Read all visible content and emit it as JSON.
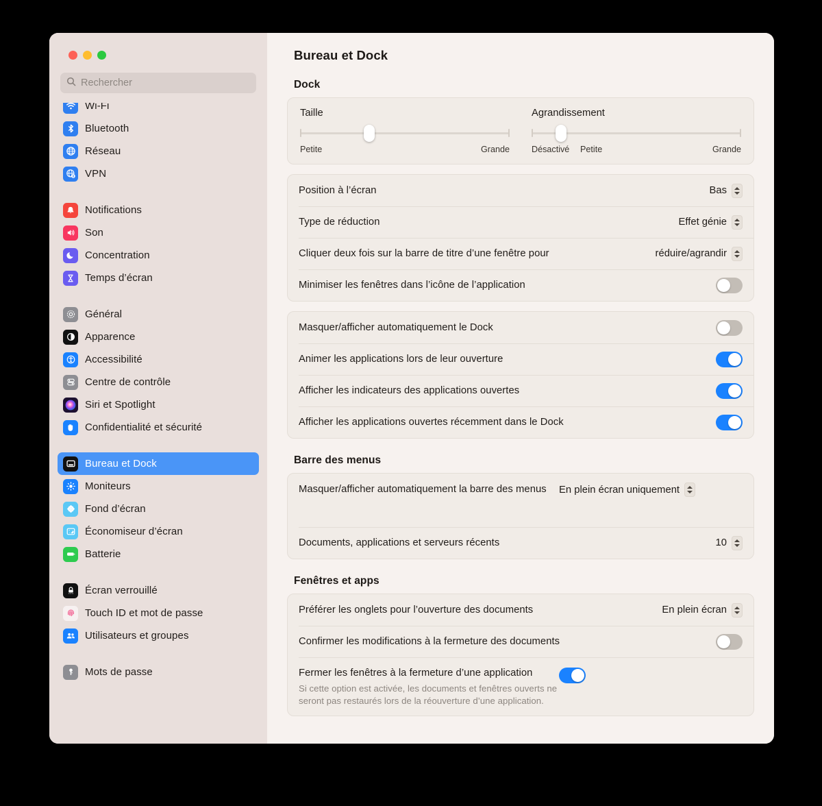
{
  "window": {
    "traffic_lights": [
      "close",
      "minimize",
      "maximize"
    ],
    "colors": {
      "accent": "#1a82ff",
      "sidebar_bg": "#e9dfdc",
      "content_bg": "#f7f2ef",
      "card_bg": "#f1ece7",
      "selected_bg": "#4a95f7"
    }
  },
  "search": {
    "placeholder": "Rechercher",
    "value": ""
  },
  "sidebar": {
    "groups": [
      {
        "items": [
          {
            "label": "Wi-Fi",
            "icon": "wifi-icon",
            "selected": false
          },
          {
            "label": "Bluetooth",
            "icon": "bluetooth-icon",
            "selected": false
          },
          {
            "label": "Réseau",
            "icon": "network-globe-icon",
            "selected": false
          },
          {
            "label": "VPN",
            "icon": "vpn-globe-icon",
            "selected": false
          }
        ]
      },
      {
        "items": [
          {
            "label": "Notifications",
            "icon": "bell-icon",
            "selected": false
          },
          {
            "label": "Son",
            "icon": "speaker-icon",
            "selected": false
          },
          {
            "label": "Concentration",
            "icon": "moon-icon",
            "selected": false
          },
          {
            "label": "Temps d’écran",
            "icon": "hourglass-icon",
            "selected": false
          }
        ]
      },
      {
        "items": [
          {
            "label": "Général",
            "icon": "gear-icon",
            "selected": false
          },
          {
            "label": "Apparence",
            "icon": "appearance-icon",
            "selected": false
          },
          {
            "label": "Accessibilité",
            "icon": "accessibility-icon",
            "selected": false
          },
          {
            "label": "Centre de contrôle",
            "icon": "control-center-icon",
            "selected": false
          },
          {
            "label": "Siri et Spotlight",
            "icon": "siri-icon",
            "selected": false
          },
          {
            "label": "Confidentialité et sécurité",
            "icon": "hand-privacy-icon",
            "selected": false
          }
        ]
      },
      {
        "items": [
          {
            "label": "Bureau et Dock",
            "icon": "desktop-dock-icon",
            "selected": true
          },
          {
            "label": "Moniteurs",
            "icon": "display-brightness-icon",
            "selected": false
          },
          {
            "label": "Fond d’écran",
            "icon": "wallpaper-icon",
            "selected": false
          },
          {
            "label": "Économiseur d’écran",
            "icon": "screensaver-icon",
            "selected": false
          },
          {
            "label": "Batterie",
            "icon": "battery-icon",
            "selected": false
          }
        ]
      },
      {
        "items": [
          {
            "label": "Écran verrouillé",
            "icon": "lock-screen-icon",
            "selected": false
          },
          {
            "label": "Touch ID et mot de passe",
            "icon": "touch-id-icon",
            "selected": false
          },
          {
            "label": "Utilisateurs et groupes",
            "icon": "users-groups-icon",
            "selected": false
          }
        ]
      },
      {
        "items": [
          {
            "label": "Mots de passe",
            "icon": "key-icon",
            "selected": false
          }
        ]
      }
    ]
  },
  "main": {
    "title": "Bureau et Dock",
    "sections": {
      "dock": {
        "heading": "Dock",
        "sliders": [
          {
            "title": "Taille",
            "legend_left": "Petite",
            "legend_right": "Grande",
            "value_pct": 33
          },
          {
            "title": "Agrandissement",
            "legend_left": "Désactivé",
            "legend_mid": "Petite",
            "legend_right": "Grande",
            "value_pct": 14
          }
        ],
        "popup_rows": [
          {
            "label": "Position à l’écran",
            "value": "Bas"
          },
          {
            "label": "Type de réduction",
            "value": "Effet génie"
          },
          {
            "label": "Cliquer deux fois sur la barre de titre d’une fenêtre pour",
            "value": "réduire/agrandir"
          }
        ],
        "minimize_row": {
          "label": "Minimiser les fenêtres dans l’icône de l’application",
          "on": false
        },
        "toggle_rows": [
          {
            "label": "Masquer/afficher automatiquement le Dock",
            "on": false
          },
          {
            "label": "Animer les applications lors de leur ouverture",
            "on": true
          },
          {
            "label": "Afficher les indicateurs des applications ouvertes",
            "on": true
          },
          {
            "label": "Afficher les applications ouvertes récemment dans le Dock",
            "on": true
          }
        ]
      },
      "menu_bar": {
        "heading": "Barre des menus",
        "rows": [
          {
            "label": "Masquer/afficher automatiquement la barre des menus",
            "value": "En plein écran uniquement"
          },
          {
            "label": "Documents, applications et serveurs récents",
            "value": "10"
          }
        ]
      },
      "windows_apps": {
        "heading": "Fenêtres et apps",
        "popup_row": {
          "label": "Préférer les onglets pour l’ouverture des documents",
          "value": "En plein écran"
        },
        "confirm_row": {
          "label": "Confirmer les modifications à la fermeture des documents",
          "on": false
        },
        "close_row": {
          "label": "Fermer les fenêtres à la fermeture d’une application",
          "sub": "Si cette option est activée, les documents et fenêtres ouverts ne seront pas restaurés lors de la réouverture d’une application.",
          "on": true
        }
      }
    }
  }
}
